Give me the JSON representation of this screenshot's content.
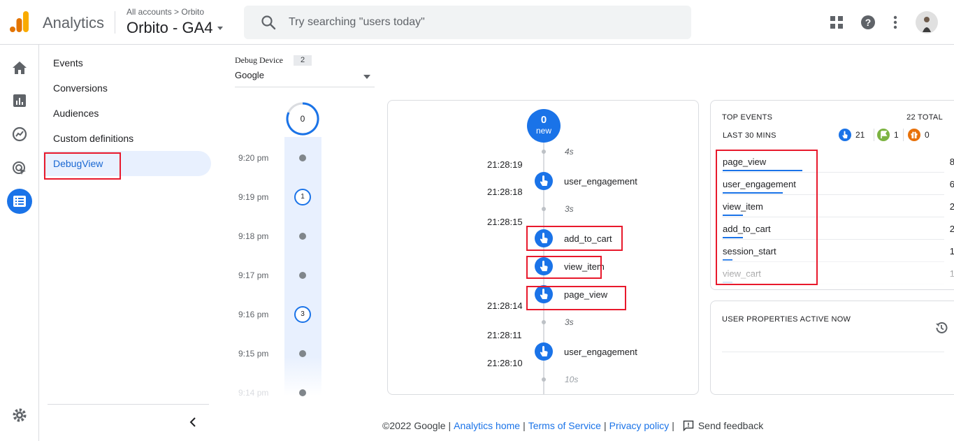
{
  "header": {
    "brand": "Analytics",
    "breadcrumb": "All accounts > Orbito",
    "property": "Orbito - GA4",
    "search_placeholder": "Try searching \"users today\""
  },
  "nav": {
    "items": [
      "Events",
      "Conversions",
      "Audiences",
      "Custom definitions"
    ],
    "active": "DebugView"
  },
  "debug_device": {
    "label": "Debug Device",
    "count": "2",
    "selected": "Google"
  },
  "minutes": {
    "top_count": "0",
    "rows": [
      {
        "time": "9:20 pm",
        "count": ""
      },
      {
        "time": "9:19 pm",
        "count": "1"
      },
      {
        "time": "9:18 pm",
        "count": ""
      },
      {
        "time": "9:17 pm",
        "count": ""
      },
      {
        "time": "9:16 pm",
        "count": "3"
      },
      {
        "time": "9:15 pm",
        "count": ""
      },
      {
        "time": "9:14 pm",
        "count": ""
      }
    ]
  },
  "stream": {
    "top_count": "0",
    "top_label": "new",
    "gaps": [
      "4s",
      "3s",
      "3s",
      "10s"
    ],
    "timestamps": [
      "21:28:19",
      "21:28:18",
      "21:28:15",
      "21:28:14",
      "21:28:11",
      "21:28:10"
    ],
    "events": [
      "user_engagement",
      "add_to_cart",
      "view_item",
      "page_view",
      "user_engagement"
    ]
  },
  "top_events": {
    "title": "TOP EVENTS",
    "total": "22 TOTAL",
    "period": "LAST 30 MINS",
    "badges": [
      {
        "icon": "touch-icon",
        "count": "21",
        "color": "#1a73e8"
      },
      {
        "icon": "flag-icon",
        "count": "1",
        "color": "#7cb342"
      },
      {
        "icon": "gift-icon",
        "count": "0",
        "color": "#e8710a"
      }
    ],
    "rows": [
      {
        "name": "page_view",
        "count": "8",
        "share": 1.0
      },
      {
        "name": "user_engagement",
        "count": "6",
        "share": 0.75
      },
      {
        "name": "view_item",
        "count": "2",
        "share": 0.25
      },
      {
        "name": "add_to_cart",
        "count": "2",
        "share": 0.25
      },
      {
        "name": "session_start",
        "count": "1",
        "share": 0.125
      },
      {
        "name": "view_cart",
        "count": "1",
        "share": 0.125
      }
    ]
  },
  "user_properties": {
    "title": "USER PROPERTIES ACTIVE NOW"
  },
  "footer": {
    "copyright": "©2022 Google",
    "links": [
      "Analytics home",
      "Terms of Service",
      "Privacy policy"
    ],
    "feedback": "Send feedback"
  },
  "colors": {
    "accent": "#1a73e8",
    "highlight": "#e8192c"
  }
}
